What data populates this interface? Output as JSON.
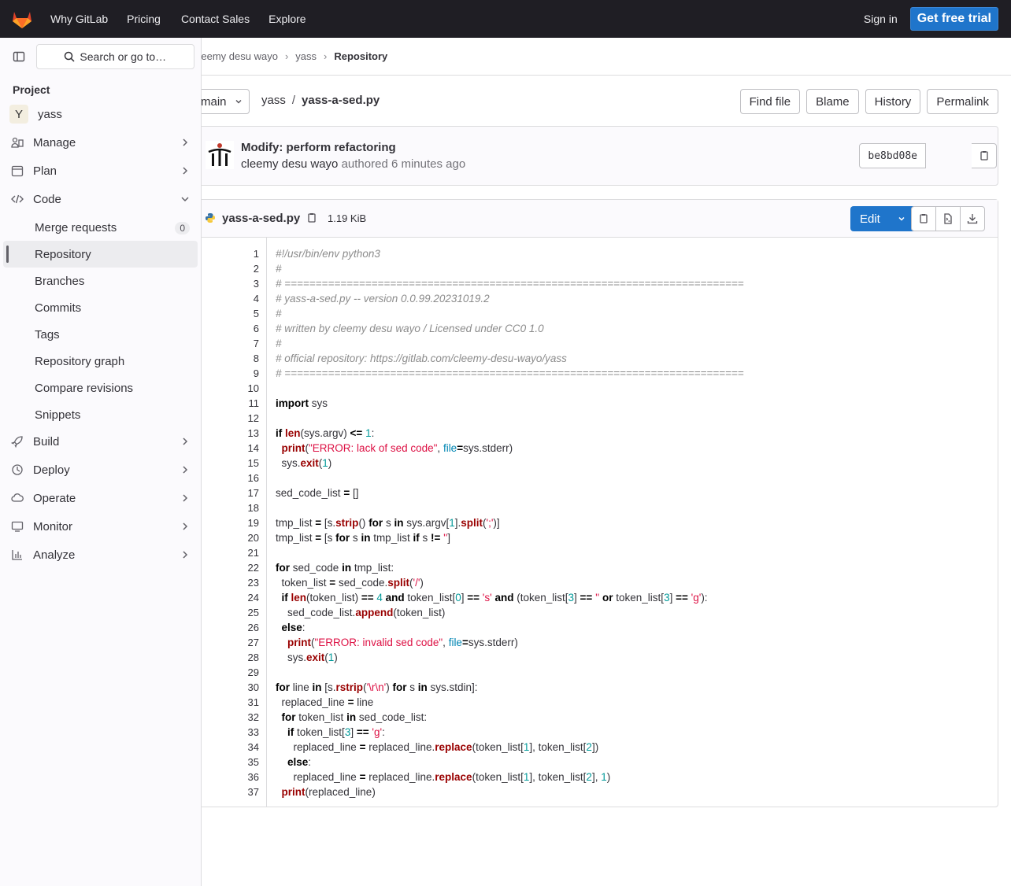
{
  "topnav": {
    "items": [
      "Why GitLab",
      "Pricing",
      "Contact Sales",
      "Explore"
    ],
    "signin": "Sign in",
    "trial": "Get free trial"
  },
  "sidebar": {
    "search": "Search or go to…",
    "section": "Project",
    "project_initial": "Y",
    "project_name": "yass",
    "items": [
      {
        "label": "Manage",
        "icon": "users-icon"
      },
      {
        "label": "Plan",
        "icon": "calendar-icon"
      },
      {
        "label": "Code",
        "icon": "code-icon"
      },
      {
        "label": "Build",
        "icon": "rocket-icon"
      },
      {
        "label": "Deploy",
        "icon": "deploy-icon"
      },
      {
        "label": "Operate",
        "icon": "cloud-icon"
      },
      {
        "label": "Monitor",
        "icon": "monitor-icon"
      },
      {
        "label": "Analyze",
        "icon": "chart-icon"
      }
    ],
    "code_sub": [
      "Merge requests",
      "Repository",
      "Branches",
      "Commits",
      "Tags",
      "Repository graph",
      "Compare revisions",
      "Snippets"
    ],
    "mr_count": "0"
  },
  "breadcrumb": [
    "cleemy desu wayo",
    "yass",
    "Repository"
  ],
  "pathbar": {
    "branch": "main",
    "repo": "yass",
    "sep": "/",
    "file": "yass-a-sed.py",
    "buttons": [
      "Find file",
      "Blame",
      "History",
      "Permalink"
    ]
  },
  "commit": {
    "title": "Modify: perform refactoring",
    "author": "cleemy desu wayo",
    "authored": "authored",
    "time": "6 minutes ago",
    "sha": "be8bd08e"
  },
  "file": {
    "name": "yass-a-sed.py",
    "size": "1.19 KiB",
    "edit": "Edit"
  },
  "code_lines": [
    "#!/usr/bin/env python3",
    "#",
    "# ==========================================================================",
    "# yass-a-sed.py -- version 0.0.99.20231019.2",
    "#",
    "# written by cleemy desu wayo / Licensed under CC0 1.0",
    "#",
    "# official repository: https://gitlab.com/cleemy-desu-wayo/yass",
    "# ==========================================================================",
    "",
    "import sys",
    "",
    "if len(sys.argv) <= 1:",
    "    print(\"ERROR: lack of sed code\", file=sys.stderr)",
    "    sys.exit(1)",
    "",
    "sed_code_list = []",
    "",
    "tmp_list = [s.strip() for s in sys.argv[1].split(';')]",
    "tmp_list = [s for s in tmp_list if s != '']",
    "",
    "for sed_code in tmp_list:",
    "    token_list = sed_code.split('/')",
    "    if len(token_list) == 4 and token_list[0] == 's' and (token_list[3] == '' or token_list[3] == 'g'):",
    "        sed_code_list.append(token_list)",
    "    else:",
    "        print(\"ERROR: invalid sed code\", file=sys.stderr)",
    "        sys.exit(1)",
    "",
    "for line in [s.rstrip('\\r\\n') for s in sys.stdin]:",
    "    replaced_line = line",
    "    for token_list in sed_code_list:",
    "        if token_list[3] == 'g':",
    "            replaced_line = replaced_line.replace(token_list[1], token_list[2])",
    "        else:",
    "            replaced_line = replaced_line.replace(token_list[1], token_list[2], 1)",
    "    print(replaced_line)"
  ]
}
